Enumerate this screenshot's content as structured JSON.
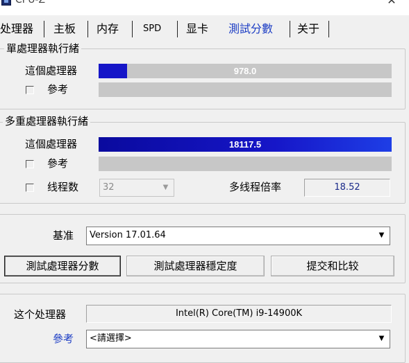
{
  "window": {
    "title": "CPU-Z",
    "close_glyph": "✕"
  },
  "tabs": [
    {
      "label": "处理器"
    },
    {
      "label": "主板"
    },
    {
      "label": "内存"
    },
    {
      "label": "SPD"
    },
    {
      "label": "显卡"
    },
    {
      "label": "測試分數",
      "active": true
    },
    {
      "label": "关于"
    }
  ],
  "single_thread": {
    "title": "單處理器執行緒",
    "this_cpu_label": "這個處理器",
    "this_cpu_score": "978.0",
    "this_cpu_fill_fraction": 0.097,
    "reference_label": "參考"
  },
  "multi_thread": {
    "title": "多重處理器執行緒",
    "this_cpu_label": "這個處理器",
    "this_cpu_score": "18117.5",
    "this_cpu_fill_fraction": 1.0,
    "reference_label": "參考",
    "threads_label": "线程数",
    "threads_value": "32",
    "ratio_label": "多线程倍率",
    "ratio_value": "18.52"
  },
  "benchmark": {
    "label": "基准",
    "version": "Version 17.01.64",
    "bench_cpu_button": "測試處理器分數",
    "stress_cpu_button": "測試處理器穩定度",
    "submit_button": "提交和比较"
  },
  "compare": {
    "this_cpu_label": "这个处理器",
    "this_cpu_name": "Intel(R) Core(TM) i9-14900K",
    "reference_label": "參考",
    "reference_placeholder": "<請選擇>"
  },
  "colors": {
    "bar_fill": "#1616c8",
    "bar_track": "#c7c7c7",
    "active_tab": "#1b3cc4",
    "ratio_text": "#1a2a8a"
  },
  "icons": {
    "app": "cpuz-chip-icon",
    "close": "close-icon",
    "dropdown": "chevron-down-icon"
  }
}
